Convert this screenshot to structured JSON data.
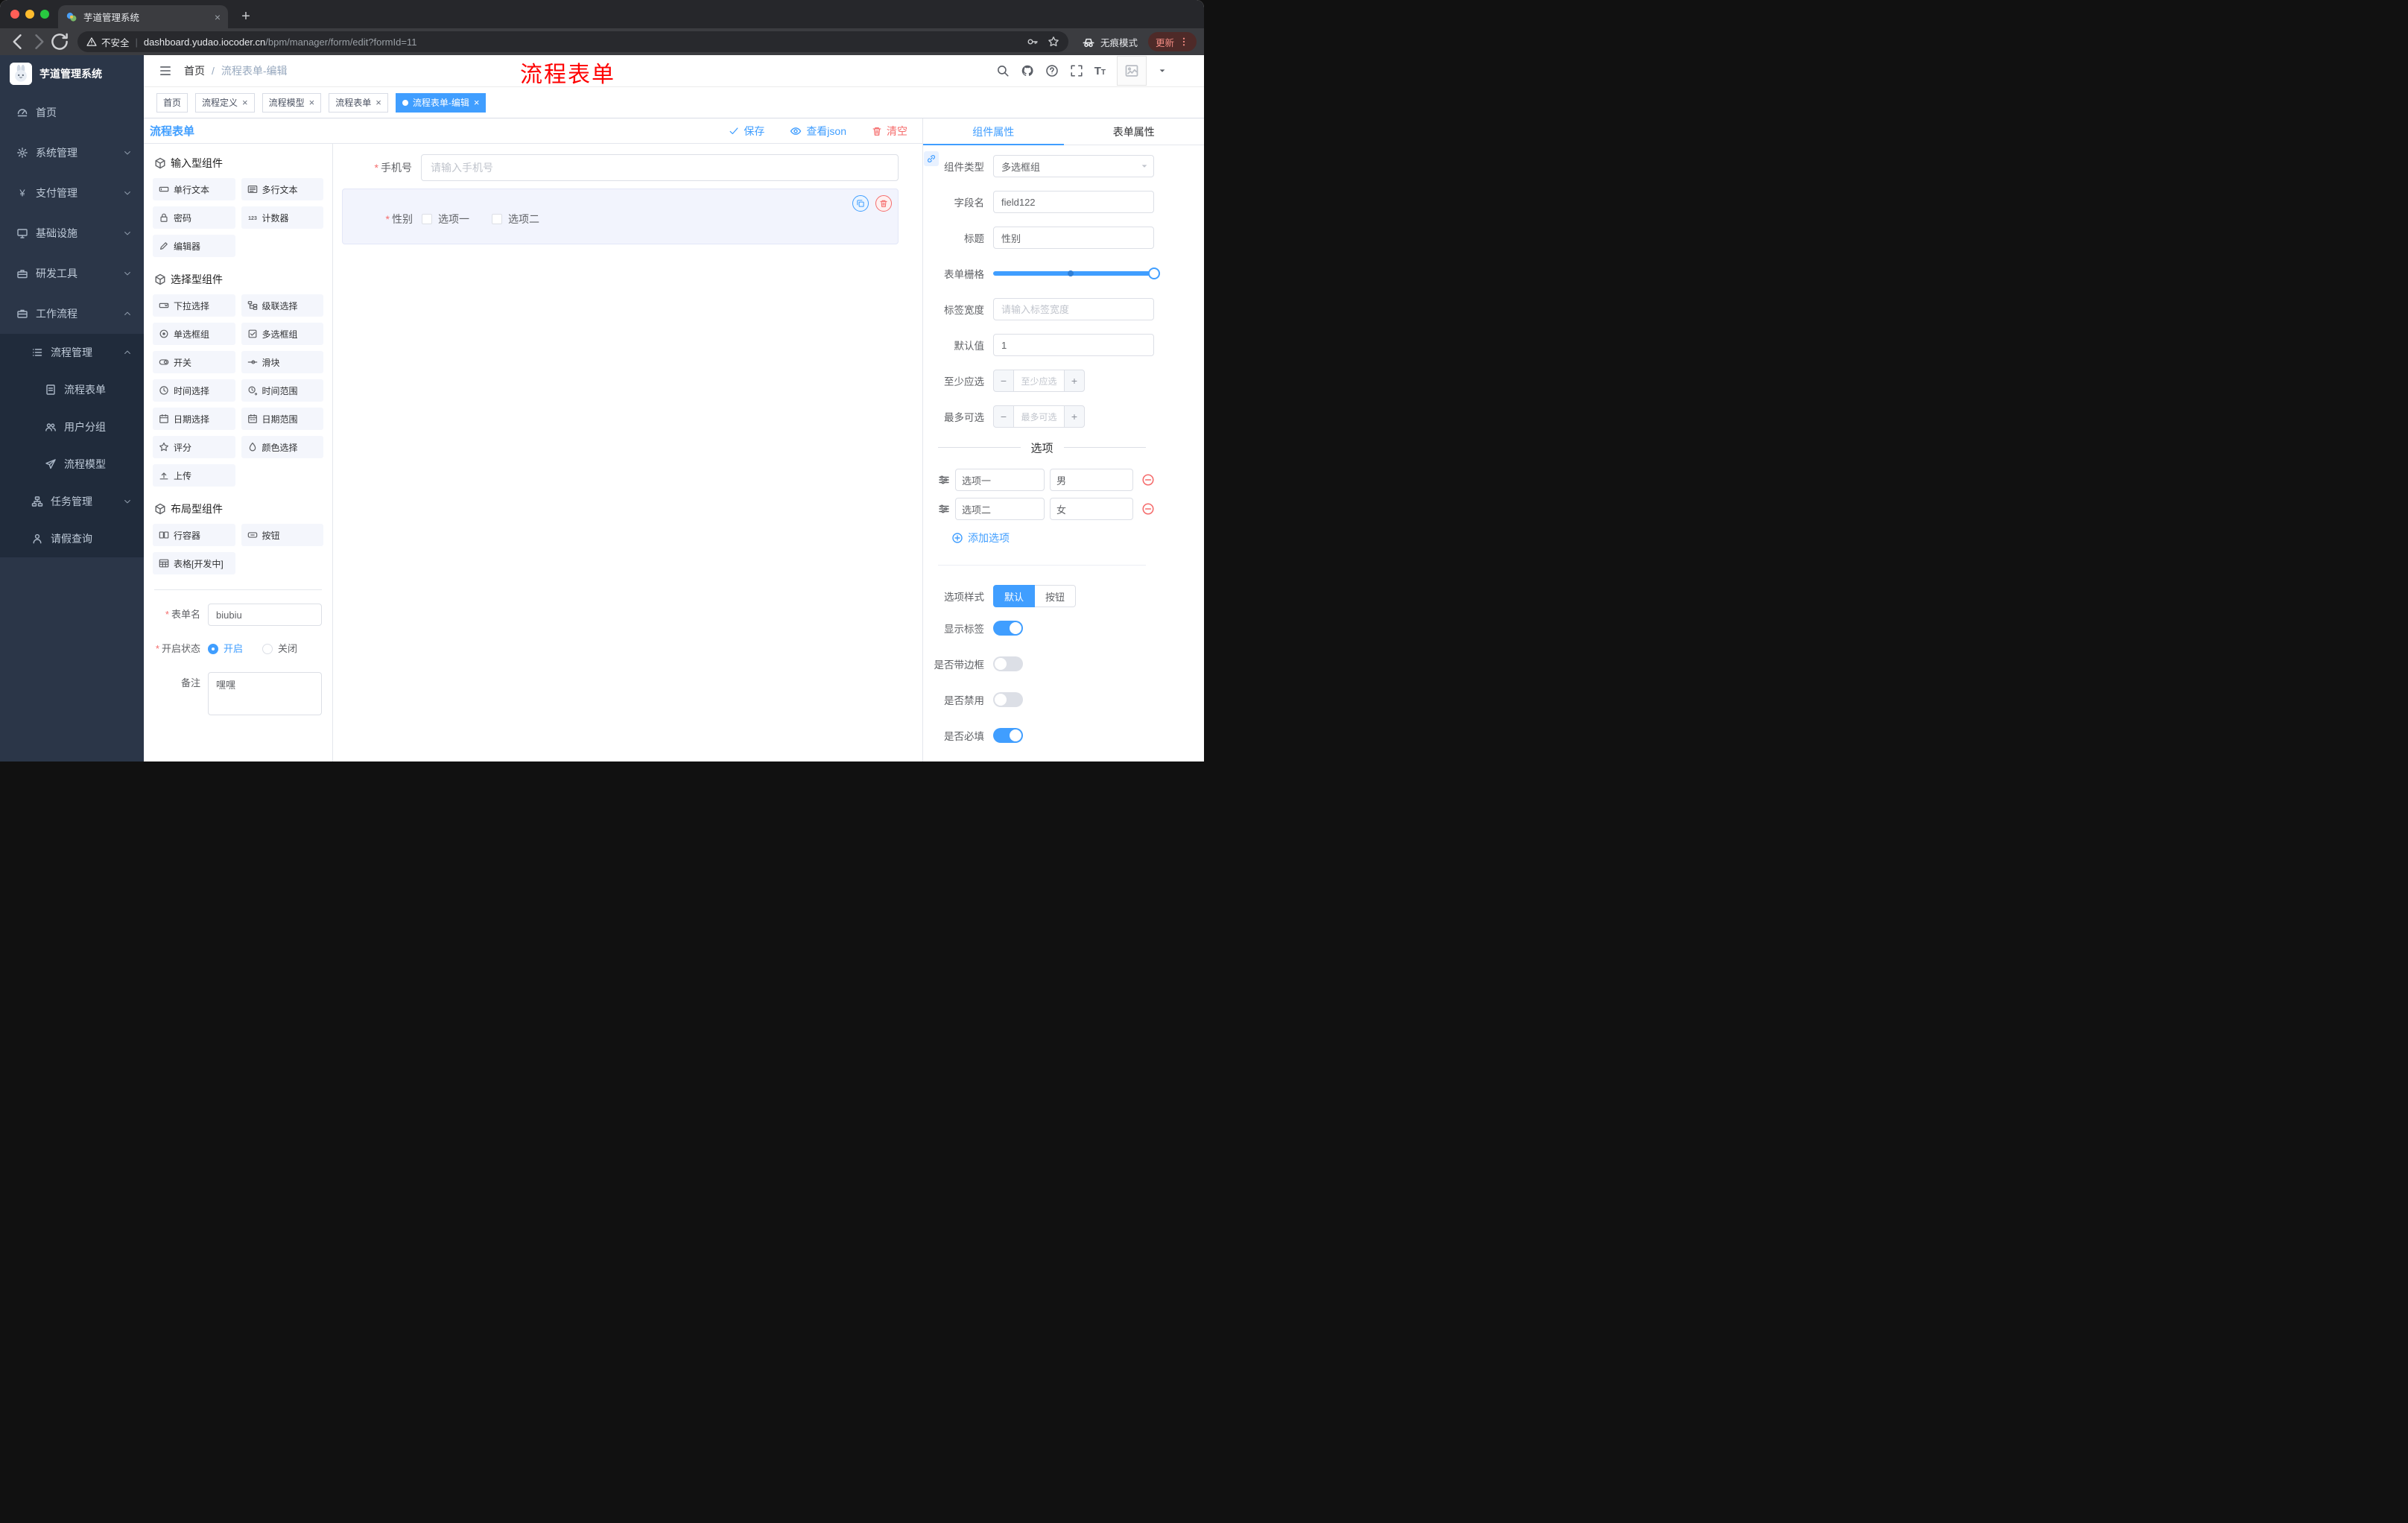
{
  "colors": {
    "primary": "#409eff",
    "danger": "#f56c6c",
    "annotation": "#fe0000",
    "sidebar_bg": "#2b3648"
  },
  "browser": {
    "tab_title": "芋道管理系统",
    "security_label": "不安全",
    "url_host": "dashboard.yudao.iocoder.cn",
    "url_path": "/bpm/manager/form/edit?formId=11",
    "incognito_label": "无痕模式",
    "update_label": "更新"
  },
  "sidebar": {
    "logo_title": "芋道管理系统",
    "items": [
      {
        "label": "首页",
        "icon": "dashboard",
        "cls": "lvl1"
      },
      {
        "label": "系统管理",
        "icon": "gear",
        "cls": "lvl1",
        "arrow": "chevron-down"
      },
      {
        "label": "支付管理",
        "icon": "yen",
        "cls": "lvl1",
        "arrow": "chevron-down"
      },
      {
        "label": "基础设施",
        "icon": "infra",
        "cls": "lvl1",
        "arrow": "chevron-down"
      },
      {
        "label": "研发工具",
        "icon": "devtool",
        "cls": "lvl1",
        "arrow": "chevron-down"
      },
      {
        "label": "工作流程",
        "icon": "workflow",
        "cls": "lvl1",
        "arrow": "chevron-up"
      },
      {
        "label": "流程管理",
        "icon": "list",
        "cls": "lvl2 sub",
        "arrow": "chevron-up"
      },
      {
        "label": "流程表单",
        "icon": "doc",
        "cls": "lvl3 sub"
      },
      {
        "label": "用户分组",
        "icon": "group",
        "cls": "lvl3 sub"
      },
      {
        "label": "流程模型",
        "icon": "send",
        "cls": "lvl3 sub"
      },
      {
        "label": "任务管理",
        "icon": "tree",
        "cls": "lvl2 sub",
        "arrow": "chevron-down"
      },
      {
        "label": "请假查询",
        "icon": "person",
        "cls": "lvl2 sub"
      }
    ]
  },
  "header": {
    "breadcrumb": [
      "首页",
      "流程表单-编辑"
    ],
    "breadcrumb_separator": "/",
    "annotation": "流程表单"
  },
  "tags_view": {
    "tabs": [
      {
        "label": "首页",
        "cls": "no-close"
      },
      {
        "label": "流程定义",
        "cls": ""
      },
      {
        "label": "流程模型",
        "cls": ""
      },
      {
        "label": "流程表单",
        "cls": ""
      },
      {
        "label": "流程表单-编辑",
        "cls": "active"
      }
    ]
  },
  "designer": {
    "title": "流程表单",
    "actions": {
      "save": "保存",
      "view_json": "查看json",
      "clear": "清空"
    },
    "components": {
      "sections": [
        {
          "title": "输入型组件",
          "items": [
            {
              "label": "单行文本",
              "icon": "input"
            },
            {
              "label": "多行文本",
              "icon": "textarea"
            },
            {
              "label": "密码",
              "icon": "lock"
            },
            {
              "label": "计数器",
              "icon": "counter"
            },
            {
              "label": "编辑器",
              "icon": "pen"
            }
          ]
        },
        {
          "title": "选择型组件",
          "items": [
            {
              "label": "下拉选择",
              "icon": "select"
            },
            {
              "label": "级联选择",
              "icon": "cascader"
            },
            {
              "label": "单选框组",
              "icon": "radio"
            },
            {
              "label": "多选框组",
              "icon": "checkbox"
            },
            {
              "label": "开关",
              "icon": "switch"
            },
            {
              "label": "滑块",
              "icon": "slider"
            },
            {
              "label": "时间选择",
              "icon": "clock"
            },
            {
              "label": "时间范围",
              "icon": "clock-range"
            },
            {
              "label": "日期选择",
              "icon": "calendar"
            },
            {
              "label": "日期范围",
              "icon": "calendar-range"
            },
            {
              "label": "评分",
              "icon": "star"
            },
            {
              "label": "颜色选择",
              "icon": "droplet"
            },
            {
              "label": "上传",
              "icon": "upload"
            }
          ]
        },
        {
          "title": "布局型组件",
          "items": [
            {
              "label": "行容器",
              "icon": "columns"
            },
            {
              "label": "按钮",
              "icon": "button"
            },
            {
              "label": "表格[开发中]",
              "icon": "table"
            }
          ]
        }
      ]
    },
    "form_meta": {
      "name_label": "表单名",
      "name_value": "biubiu",
      "status_label": "开启状态",
      "status_options": [
        "开启",
        "关闭"
      ],
      "status_selected": "开启",
      "remark_label": "备注",
      "remark_value": "嘿嘿"
    },
    "canvas": {
      "phone_label": "手机号",
      "phone_placeholder": "请输入手机号",
      "gender_label": "性别",
      "gender_options": [
        "选项一",
        "选项二"
      ]
    }
  },
  "properties": {
    "tabs": [
      "组件属性",
      "表单属性"
    ],
    "active_tab": "组件属性",
    "fields": {
      "component_type_label": "组件类型",
      "component_type_value": "多选框组",
      "field_name_label": "字段名",
      "field_name_value": "field122",
      "title_label": "标题",
      "title_value": "性别",
      "grid_label": "表单栅格",
      "label_width_label": "标签宽度",
      "label_width_placeholder": "请输入标签宽度",
      "default_label": "默认值",
      "default_value": "1",
      "min_label": "至少应选",
      "min_placeholder": "至少应选",
      "max_label": "最多可选",
      "max_placeholder": "最多可选"
    },
    "options_divider": "选项",
    "options": [
      {
        "label": "选项一",
        "value": "男"
      },
      {
        "label": "选项二",
        "value": "女"
      }
    ],
    "add_option": "添加选项",
    "style_label": "选项样式",
    "style_options": [
      "默认",
      "按钮"
    ],
    "style_selected": "默认",
    "switches": [
      {
        "label": "显示标签",
        "cls": "on"
      },
      {
        "label": "是否带边框",
        "cls": ""
      },
      {
        "label": "是否禁用",
        "cls": ""
      },
      {
        "label": "是否必填",
        "cls": "on"
      }
    ]
  }
}
